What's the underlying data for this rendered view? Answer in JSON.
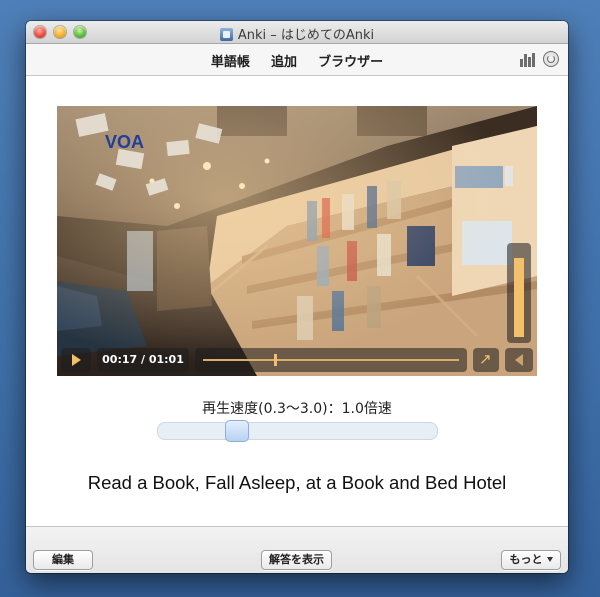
{
  "window": {
    "title": "Anki – はじめてのAnki"
  },
  "toolbar": {
    "items": [
      {
        "label": "単語帳"
      },
      {
        "label": "追加"
      },
      {
        "label": "ブラウザー"
      }
    ],
    "icons": [
      "stats-icon",
      "sync-icon"
    ]
  },
  "video": {
    "logo_text": "VOA",
    "time_display": "00:17 / 01:01",
    "progress_fraction": 0.28,
    "volume_fraction": 0.9
  },
  "playback": {
    "speed_label": "再生速度(0.3〜3.0)：1.0倍速",
    "speed_value": 1.0,
    "speed_range": [
      0.3,
      3.0
    ]
  },
  "card": {
    "sentence": "Read a Book, Fall Asleep, at a Book and Bed Hotel"
  },
  "bottom": {
    "edit_label": "編集",
    "show_answer_label": "解答を表示",
    "more_label": "もっと"
  },
  "colors": {
    "accent": "#f4c06a",
    "desktop": "#3f6fa8"
  }
}
